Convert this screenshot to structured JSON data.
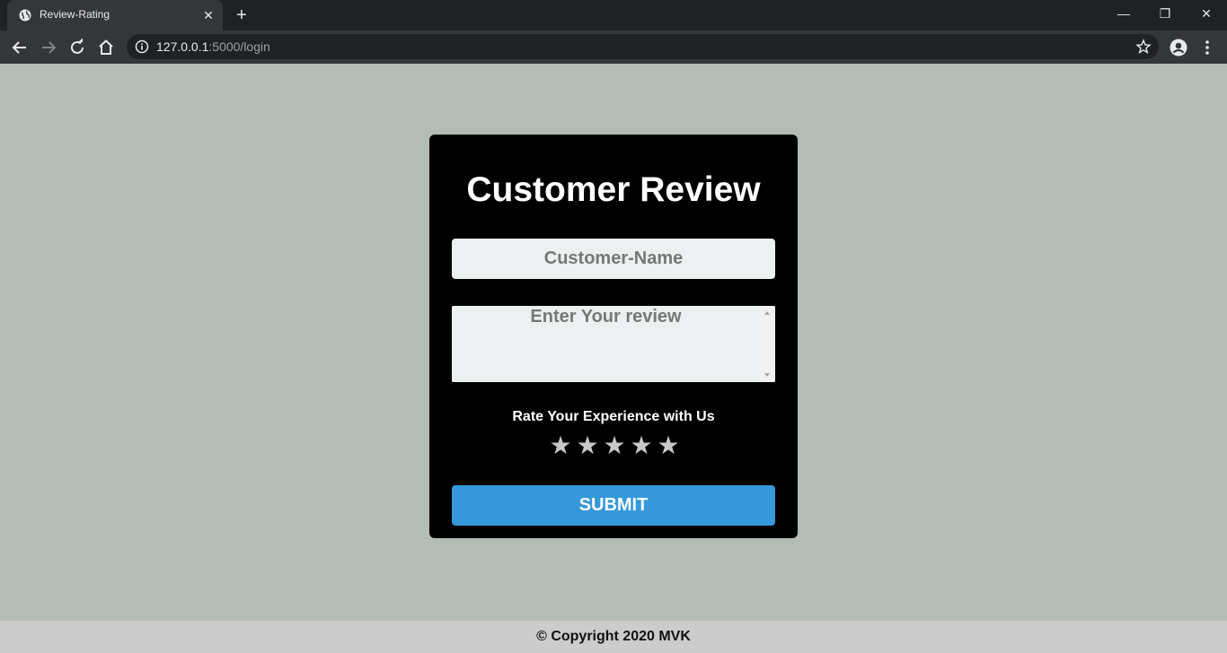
{
  "browser": {
    "tab_title": "Review-Rating",
    "tab_close": "✕",
    "new_tab": "+",
    "url_host": "127.0.0.1",
    "url_rest": ":5000/login",
    "window_controls": {
      "minimize": "—",
      "restore": "❐",
      "close": "✕"
    }
  },
  "form": {
    "title": "Customer Review",
    "name_placeholder": "Customer-Name",
    "review_placeholder": "Enter Your review",
    "rating_label": "Rate Your Experience with Us",
    "stars": [
      "★",
      "★",
      "★",
      "★",
      "★"
    ],
    "rating_value": 0,
    "submit_label": "SUBMIT"
  },
  "footer": {
    "text": "© Copyright 2020 MVK"
  },
  "colors": {
    "page_bg": "#b3bdb5",
    "card_bg": "#000000",
    "accent": "#3498db",
    "footer_bg": "#cccccc",
    "star_color": "#c8c8c8"
  }
}
